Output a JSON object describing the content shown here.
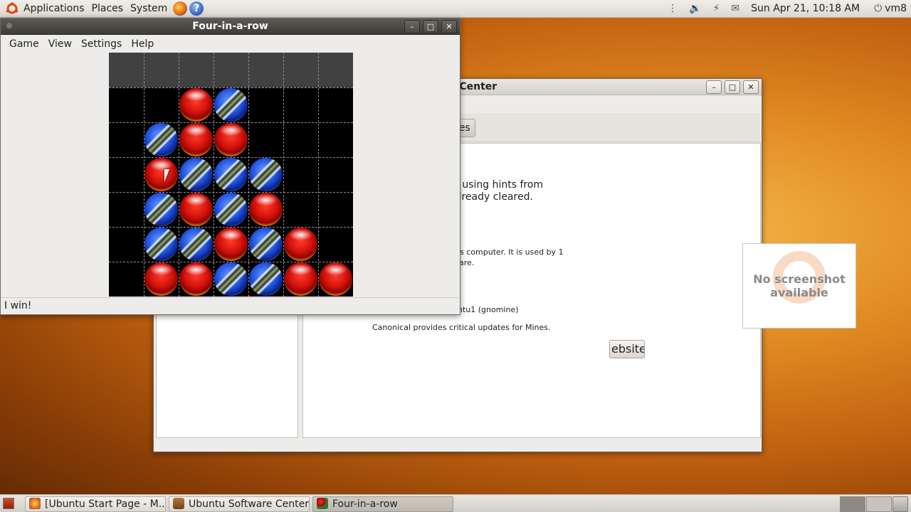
{
  "top_panel": {
    "menus": [
      "Applications",
      "Places",
      "System"
    ],
    "clock": "Sun Apr 21, 10:18 AM",
    "user": "vm8"
  },
  "software_center": {
    "title": "e Center",
    "toolbar_tab": "nes",
    "desc_line1": "d using hints from",
    "desc_line2": "already cleared.",
    "installed_line1": "his computer. It is used by 1",
    "installed_line2": "ware.",
    "website_button": "ebsite",
    "version": "untu1 (gnomine)",
    "updates": "Canonical provides critical updates for Mines.",
    "screenshot_placeholder_1": "No screenshot",
    "screenshot_placeholder_2": "available"
  },
  "four_in_a_row": {
    "title": "Four-in-a-row",
    "menu": [
      "Game",
      "View",
      "Settings",
      "Help"
    ],
    "status": "I win!",
    "board": [
      [
        "",
        "",
        "R",
        "B",
        "",
        "",
        ""
      ],
      [
        "",
        "B",
        "R",
        "R",
        "",
        "",
        ""
      ],
      [
        "",
        "R",
        "B",
        "B",
        "B",
        "",
        ""
      ],
      [
        "",
        "B",
        "R",
        "B",
        "R",
        "",
        ""
      ],
      [
        "",
        "B",
        "B",
        "R",
        "B",
        "R",
        ""
      ],
      [
        "",
        "R",
        "R",
        "B",
        "B",
        "R",
        "R"
      ]
    ]
  },
  "taskbar": {
    "items": [
      {
        "label": "[Ubuntu Start Page - M...",
        "active": false
      },
      {
        "label": "Ubuntu Software Center",
        "active": false
      },
      {
        "label": "Four-in-a-row",
        "active": true
      }
    ]
  },
  "colors": {
    "red_marble": "#d1100a",
    "blue_marble": "#1f52e0",
    "board_background": "#000000",
    "titlebar_active": "#3e3c39"
  }
}
